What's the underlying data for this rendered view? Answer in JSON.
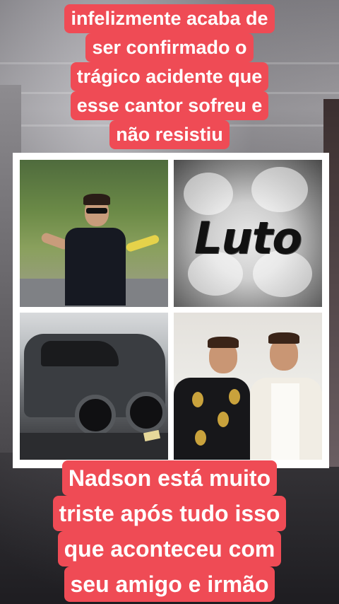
{
  "top_caption": {
    "lines": [
      "infelizmente acaba de",
      "ser confirmado o",
      "trágico acidente que",
      "esse cantor sofreu e",
      "não resistiu"
    ]
  },
  "collage": {
    "luto_label": "Luto"
  },
  "bottom_caption": {
    "lines": [
      "Nadson está muito",
      "triste após tudo isso",
      "que aconteceu com",
      "seu amigo e irmão"
    ]
  },
  "colors": {
    "caption_bg": "#ef4b55",
    "caption_text": "#ffffff",
    "collage_border": "#ffffff"
  }
}
